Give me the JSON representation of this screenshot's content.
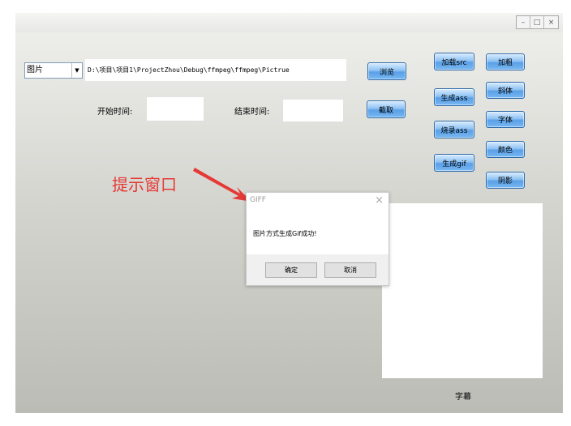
{
  "window": {
    "controls": {
      "minimize": "–",
      "maximize": "□",
      "close": "×"
    }
  },
  "source": {
    "type_selected": "图片",
    "path_value": "D:\\项目\\项目1\\ProjectZhou\\Debug\\ffmpeg\\ffmpeg\\Pictrue"
  },
  "time": {
    "start_label": "开始时间:",
    "end_label": "结束时间:"
  },
  "buttons": {
    "browse": "浏览",
    "capture": "截取",
    "load_src": "加载src",
    "gen_ass": "生成ass",
    "burn_ass": "烧录ass",
    "gen_gif": "生成gif",
    "bold": "加粗",
    "italic": "斜体",
    "font": "字体",
    "color": "颜色",
    "shadow": "阴影"
  },
  "subtitle": {
    "label": "字幕"
  },
  "annotation": {
    "text": "提示窗口",
    "color": "#e53935"
  },
  "dialog": {
    "title": "GIFF",
    "close": "×",
    "message": "图片方式生成Gif成功!",
    "ok": "确定",
    "cancel": "取消"
  }
}
